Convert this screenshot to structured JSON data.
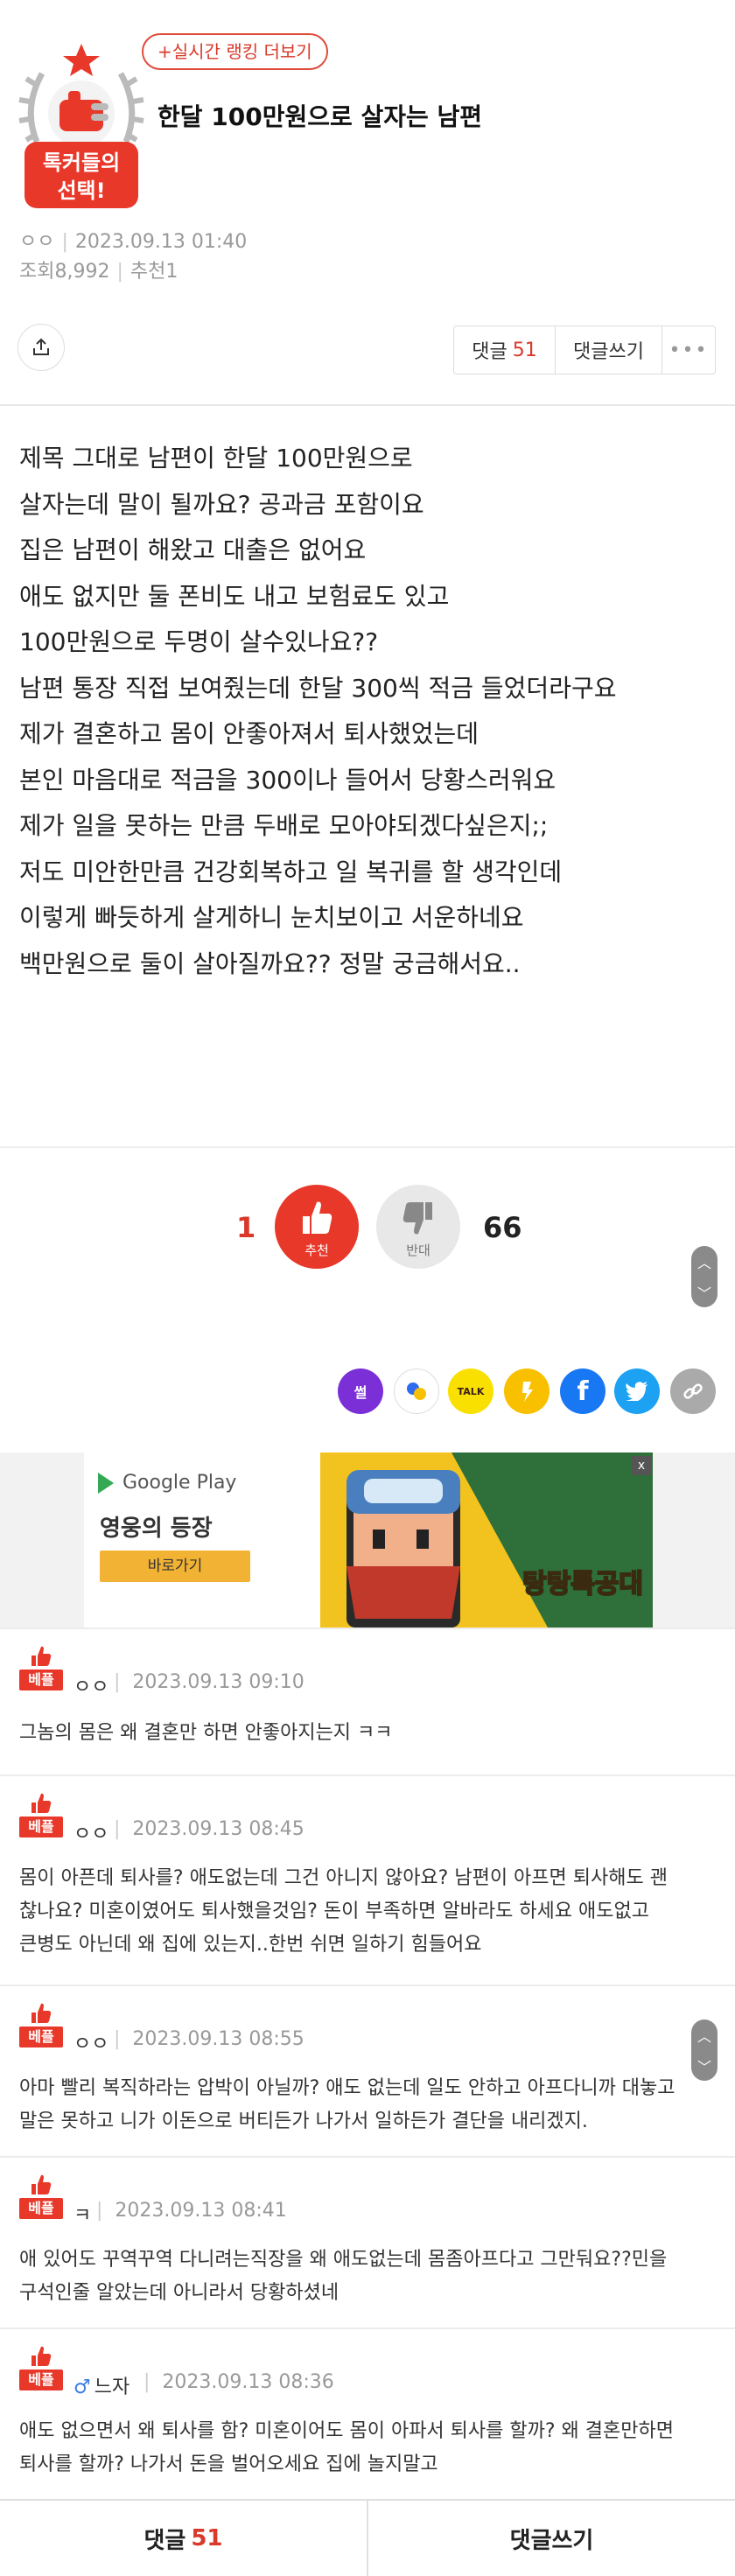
{
  "header": {
    "rank_button": "+실시간 랭킹 더보기",
    "badge_line1": "톡커들의",
    "badge_line2": "선택!",
    "title": "한달 100만원으로 살자는 남편",
    "author": "ㅇㅇ",
    "date": "2023.09.13 01:40",
    "views": "조회8,992",
    "recommends": "추천1"
  },
  "actions": {
    "comment_label": "댓글",
    "comment_count": "51",
    "write_label": "댓글쓰기",
    "more_label": "•••"
  },
  "post_lines": [
    "제목 그대로 남편이 한달 100만원으로",
    "살자는데 말이 될까요? 공과금 포함이요",
    "집은 남편이 해왔고 대출은 없어요",
    "애도 없지만 둘 폰비도 내고 보험료도 있고",
    "100만원으로 두명이 살수있나요??",
    "남편 통장 직접 보여줬는데 한달 300씩 적금 들었더라구요",
    "제가 결혼하고 몸이 안좋아져서 퇴사했었는데",
    "본인 마음대로 적금을 300이나 들어서 당황스러워요",
    "제가 일을 못하는 만큼 두배로 모아야되겠다싶은지;;",
    "저도 미안한만큼 건강회복하고 일 복귀를 할 생각인데",
    "이렇게 빠듯하게 살게하니 눈치보이고 서운하네요",
    "백만원으로 둘이 살아질까요?? 정말 궁금해서요.."
  ],
  "votes": {
    "up_count": "1",
    "up_label": "추천",
    "down_label": "반대",
    "down_count": "66"
  },
  "share_icons": [
    {
      "name": "sseol-icon",
      "label": "썰",
      "color": "#7b2fd6"
    },
    {
      "name": "bubble-icon",
      "label": "",
      "color": "#ffffff"
    },
    {
      "name": "kakaotalk-icon",
      "label": "TALK",
      "color": "#f9e000"
    },
    {
      "name": "kakaostory-icon",
      "label": "",
      "color": "#f9c000"
    },
    {
      "name": "facebook-icon",
      "label": "f",
      "color": "#1877f2"
    },
    {
      "name": "twitter-icon",
      "label": "",
      "color": "#1da1f2"
    },
    {
      "name": "link-icon",
      "label": "",
      "color": "#aaaaaa"
    }
  ],
  "ad": {
    "store": "Google Play",
    "headline": "영웅의 등장",
    "cta": "바로가기",
    "game_title": "탕탕특공대",
    "close": "x"
  },
  "comments": [
    {
      "best": "베플",
      "author": "ㅇㅇ",
      "male": "",
      "date": "2023.09.13 09:10",
      "lines": [
        "그놈의 몸은 왜 결혼만 하면 안좋아지는지 ㅋㅋ"
      ]
    },
    {
      "best": "베플",
      "author": "ㅇㅇ",
      "male": "",
      "date": "2023.09.13 08:45",
      "lines": [
        "몸이 아픈데 퇴사를? 애도없는데 그건 아니지 않아요? 남편이 아프면 퇴사해도 괜",
        "찮나요? 미혼이였어도 퇴사했을것임? 돈이 부족하면 알바라도 하세요 애도없고",
        "큰병도 아닌데 왜 집에 있는지..한번 쉬면 일하기 힘들어요"
      ]
    },
    {
      "best": "베플",
      "author": "ㅇㅇ",
      "male": "",
      "date": "2023.09.13 08:55",
      "lines": [
        "아마 빨리 복직하라는 압박이 아닐까? 애도 없는데 일도 안하고 아프다니까 대놓고",
        "말은 못하고 니가 이돈으로 버티든가 나가서 일하든가 결단을 내리겠지."
      ]
    },
    {
      "best": "베플",
      "author": "ㅋ",
      "male": "",
      "date": "2023.09.13 08:41",
      "lines": [
        "애 있어도 꾸역꾸역 다니려는직장을 왜 애도없는데 몸좀아프다고 그만둬요??민을",
        "구석인줄 알았는데 아니라서 당황하셨네"
      ]
    },
    {
      "best": "베플",
      "author": "느자",
      "male": "♂",
      "date": "2023.09.13 08:36",
      "lines": [
        "애도 없으면서 왜 퇴사를 함? 미혼이어도 몸이 아파서 퇴사를 할까? 왜 결혼만하면",
        "퇴사를 할까? 나가서 돈을 벌어오세요 집에 놀지말고"
      ]
    }
  ],
  "bottom_bar": {
    "comment_label": "댓글",
    "comment_count": "51",
    "write_label": "댓글쓰기"
  },
  "colors": {
    "accent": "#d8392a",
    "vote_up": "#e8382a",
    "vote_down": "#e8e8e8"
  }
}
